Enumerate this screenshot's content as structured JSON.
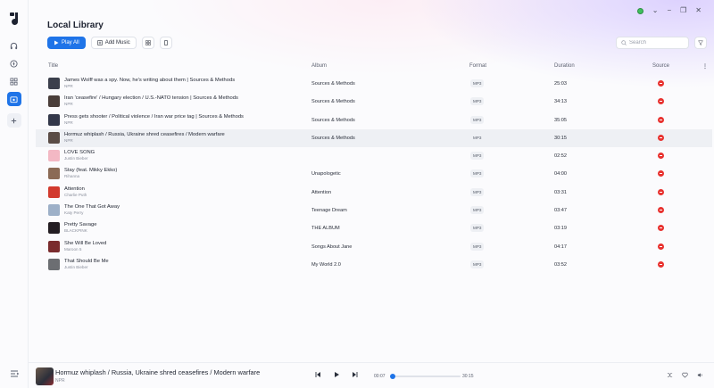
{
  "window": {
    "controls": [
      "⌄",
      "−",
      "❐",
      "✕"
    ]
  },
  "page": {
    "title": "Local Library",
    "play_all": "Play All",
    "add_music": "Add Music",
    "search_placeholder": "Search"
  },
  "table": {
    "headers": {
      "title": "Title",
      "album": "Album",
      "format": "Format",
      "duration": "Duration",
      "source": "Source"
    },
    "rows": [
      {
        "title": "James Wolff was a spy. Now, he's writing about them | Sources & Methods",
        "artist": "NPR",
        "album": "Sources & Methods",
        "format": "MP3",
        "duration": "25:03",
        "thumb": "#3b3f4c"
      },
      {
        "title": "Iran 'ceasefire' / Hungary election / U.S.-NATO tension | Sources & Methods",
        "artist": "NPR",
        "album": "Sources & Methods",
        "format": "MP3",
        "duration": "34:13",
        "thumb": "#4a3e3a"
      },
      {
        "title": "Press gets shooter / Political violence / Iran war price tag | Sources & Methods",
        "artist": "NPR",
        "album": "Sources & Methods",
        "format": "MP3",
        "duration": "35:05",
        "thumb": "#33384a"
      },
      {
        "title": "Hormuz whiplash / Russia, Ukraine shred ceasefires / Modern warfare",
        "artist": "NPR",
        "album": "Sources & Methods",
        "format": "MP3",
        "duration": "30:15",
        "thumb": "#5a4c46"
      },
      {
        "title": "LOVE SONG",
        "artist": "Justin Bieber",
        "album": "",
        "format": "MP3",
        "duration": "02:52",
        "thumb": "#f3b8c4"
      },
      {
        "title": "Stay (feat. Mikky Ekko)",
        "artist": "Rihanna",
        "album": "Unapologetic",
        "format": "MP3",
        "duration": "04:00",
        "thumb": "#8b6a55"
      },
      {
        "title": "Attention",
        "artist": "Charlie Puth",
        "album": "Attention",
        "format": "MP3",
        "duration": "03:31",
        "thumb": "#d23a2e"
      },
      {
        "title": "The One That Got Away",
        "artist": "Katy Perry",
        "album": "Teenage Dream",
        "format": "MP3",
        "duration": "03:47",
        "thumb": "#9db0c8"
      },
      {
        "title": "Pretty Savage",
        "artist": "BLACKPINK",
        "album": "THE ALBUM",
        "format": "MP3",
        "duration": "03:19",
        "thumb": "#231d22"
      },
      {
        "title": "She Will Be Loved",
        "artist": "Maroon 5",
        "album": "Songs About Jane",
        "format": "MP3",
        "duration": "04:17",
        "thumb": "#7a2c2e"
      },
      {
        "title": "That Should Be Me",
        "artist": "Justin Bieber",
        "album": "My World 2.0",
        "format": "MP3",
        "duration": "03:52",
        "thumb": "#6c6e72"
      }
    ]
  },
  "player": {
    "title": "Hormuz whiplash / Russia, Ukraine shred ceasefires / Modern warfare",
    "artist": "NPR",
    "current_time": "00:07",
    "total_time": "30:15",
    "progress": 0.004
  },
  "colors": {
    "accent": "#1f74e8",
    "source_badge": "#e8322f",
    "status_dot": "#3fbf5c"
  }
}
